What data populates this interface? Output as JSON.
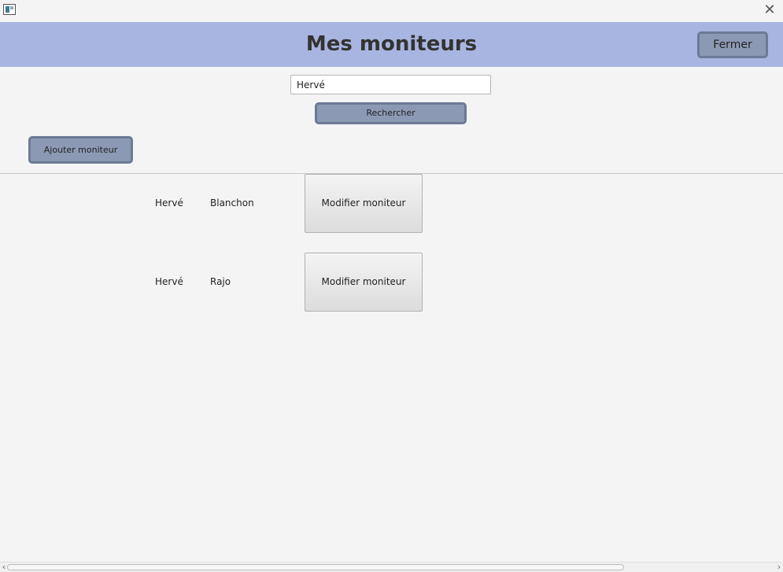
{
  "window": {
    "close_glyph": "✕"
  },
  "header": {
    "title": "Mes moniteurs",
    "close_label": "Fermer",
    "background": "#a8b5e0"
  },
  "search": {
    "value": "Hervé",
    "button_label": "Rechercher"
  },
  "actions": {
    "add_label": "Ajouter moniteur"
  },
  "instructors": [
    {
      "first_name": "Hervé",
      "last_name": "Blanchon",
      "edit_label": "Modifier moniteur"
    },
    {
      "first_name": "Hervé",
      "last_name": "Rajo",
      "edit_label": "Modifier moniteur"
    }
  ],
  "scrollbar": {
    "left_arrow": "‹",
    "right_arrow": "›"
  }
}
